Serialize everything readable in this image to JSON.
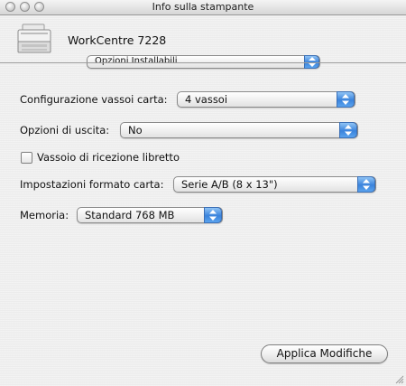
{
  "window": {
    "title": "Info sulla stampante"
  },
  "header": {
    "printer_icon": "printer-icon",
    "model": "WorkCentre 7228",
    "section_popup": "Opzioni Installabili"
  },
  "options": {
    "trays": {
      "label": "Configurazione vassoi carta:",
      "value": "4 vassoi"
    },
    "output": {
      "label": "Opzioni di uscita:",
      "value": "No"
    },
    "booklet_tray": {
      "label": "Vassoio di ricezione libretto",
      "checked": false
    },
    "paper_size": {
      "label": "Impostazioni formato carta:",
      "value": "Serie A/B (8 x 13\")"
    },
    "memory": {
      "label": "Memoria:",
      "value": "Standard 768 MB"
    }
  },
  "footer": {
    "apply_button": "Applica Modifiche"
  },
  "colors": {
    "popup_arrow_accent": "#3a83dc",
    "window_background": "#ececec"
  }
}
